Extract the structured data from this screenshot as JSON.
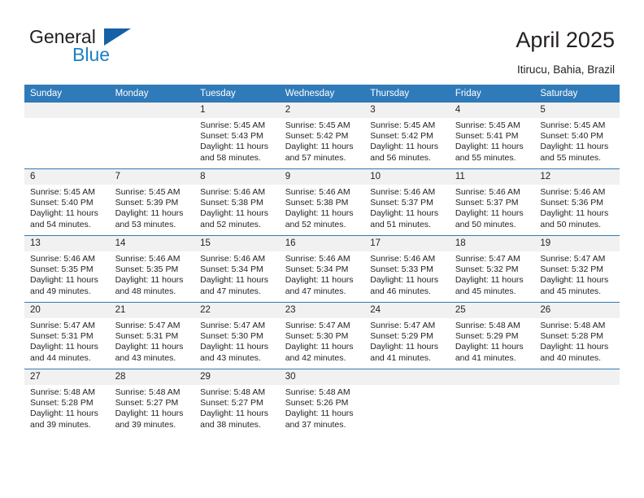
{
  "brand": {
    "word_one": "General",
    "word_two": "Blue",
    "triangle_color": "#1660a8",
    "blue_text_color": "#1d7fc4"
  },
  "header": {
    "title": "April 2025",
    "location": "Itirucu, Bahia, Brazil"
  },
  "theme": {
    "header_row_bg": "#2f7ab9",
    "daynum_bg": "#f1f1f1",
    "grid_line": "#2f7ab9",
    "text": "#231f20"
  },
  "labels": {
    "sunrise_prefix": "Sunrise:",
    "sunset_prefix": "Sunset:",
    "daylight_prefix": "Daylight:"
  },
  "weekdays": [
    "Sunday",
    "Monday",
    "Tuesday",
    "Wednesday",
    "Thursday",
    "Friday",
    "Saturday"
  ],
  "weeks": [
    [
      {
        "day": "",
        "empty": true
      },
      {
        "day": "",
        "empty": true
      },
      {
        "day": "1",
        "sunrise": "Sunrise: 5:45 AM",
        "sunset": "Sunset: 5:43 PM",
        "daylight": "Daylight: 11 hours and 58 minutes."
      },
      {
        "day": "2",
        "sunrise": "Sunrise: 5:45 AM",
        "sunset": "Sunset: 5:42 PM",
        "daylight": "Daylight: 11 hours and 57 minutes."
      },
      {
        "day": "3",
        "sunrise": "Sunrise: 5:45 AM",
        "sunset": "Sunset: 5:42 PM",
        "daylight": "Daylight: 11 hours and 56 minutes."
      },
      {
        "day": "4",
        "sunrise": "Sunrise: 5:45 AM",
        "sunset": "Sunset: 5:41 PM",
        "daylight": "Daylight: 11 hours and 55 minutes."
      },
      {
        "day": "5",
        "sunrise": "Sunrise: 5:45 AM",
        "sunset": "Sunset: 5:40 PM",
        "daylight": "Daylight: 11 hours and 55 minutes."
      }
    ],
    [
      {
        "day": "6",
        "sunrise": "Sunrise: 5:45 AM",
        "sunset": "Sunset: 5:40 PM",
        "daylight": "Daylight: 11 hours and 54 minutes."
      },
      {
        "day": "7",
        "sunrise": "Sunrise: 5:45 AM",
        "sunset": "Sunset: 5:39 PM",
        "daylight": "Daylight: 11 hours and 53 minutes."
      },
      {
        "day": "8",
        "sunrise": "Sunrise: 5:46 AM",
        "sunset": "Sunset: 5:38 PM",
        "daylight": "Daylight: 11 hours and 52 minutes."
      },
      {
        "day": "9",
        "sunrise": "Sunrise: 5:46 AM",
        "sunset": "Sunset: 5:38 PM",
        "daylight": "Daylight: 11 hours and 52 minutes."
      },
      {
        "day": "10",
        "sunrise": "Sunrise: 5:46 AM",
        "sunset": "Sunset: 5:37 PM",
        "daylight": "Daylight: 11 hours and 51 minutes."
      },
      {
        "day": "11",
        "sunrise": "Sunrise: 5:46 AM",
        "sunset": "Sunset: 5:37 PM",
        "daylight": "Daylight: 11 hours and 50 minutes."
      },
      {
        "day": "12",
        "sunrise": "Sunrise: 5:46 AM",
        "sunset": "Sunset: 5:36 PM",
        "daylight": "Daylight: 11 hours and 50 minutes."
      }
    ],
    [
      {
        "day": "13",
        "sunrise": "Sunrise: 5:46 AM",
        "sunset": "Sunset: 5:35 PM",
        "daylight": "Daylight: 11 hours and 49 minutes."
      },
      {
        "day": "14",
        "sunrise": "Sunrise: 5:46 AM",
        "sunset": "Sunset: 5:35 PM",
        "daylight": "Daylight: 11 hours and 48 minutes."
      },
      {
        "day": "15",
        "sunrise": "Sunrise: 5:46 AM",
        "sunset": "Sunset: 5:34 PM",
        "daylight": "Daylight: 11 hours and 47 minutes."
      },
      {
        "day": "16",
        "sunrise": "Sunrise: 5:46 AM",
        "sunset": "Sunset: 5:34 PM",
        "daylight": "Daylight: 11 hours and 47 minutes."
      },
      {
        "day": "17",
        "sunrise": "Sunrise: 5:46 AM",
        "sunset": "Sunset: 5:33 PM",
        "daylight": "Daylight: 11 hours and 46 minutes."
      },
      {
        "day": "18",
        "sunrise": "Sunrise: 5:47 AM",
        "sunset": "Sunset: 5:32 PM",
        "daylight": "Daylight: 11 hours and 45 minutes."
      },
      {
        "day": "19",
        "sunrise": "Sunrise: 5:47 AM",
        "sunset": "Sunset: 5:32 PM",
        "daylight": "Daylight: 11 hours and 45 minutes."
      }
    ],
    [
      {
        "day": "20",
        "sunrise": "Sunrise: 5:47 AM",
        "sunset": "Sunset: 5:31 PM",
        "daylight": "Daylight: 11 hours and 44 minutes."
      },
      {
        "day": "21",
        "sunrise": "Sunrise: 5:47 AM",
        "sunset": "Sunset: 5:31 PM",
        "daylight": "Daylight: 11 hours and 43 minutes."
      },
      {
        "day": "22",
        "sunrise": "Sunrise: 5:47 AM",
        "sunset": "Sunset: 5:30 PM",
        "daylight": "Daylight: 11 hours and 43 minutes."
      },
      {
        "day": "23",
        "sunrise": "Sunrise: 5:47 AM",
        "sunset": "Sunset: 5:30 PM",
        "daylight": "Daylight: 11 hours and 42 minutes."
      },
      {
        "day": "24",
        "sunrise": "Sunrise: 5:47 AM",
        "sunset": "Sunset: 5:29 PM",
        "daylight": "Daylight: 11 hours and 41 minutes."
      },
      {
        "day": "25",
        "sunrise": "Sunrise: 5:48 AM",
        "sunset": "Sunset: 5:29 PM",
        "daylight": "Daylight: 11 hours and 41 minutes."
      },
      {
        "day": "26",
        "sunrise": "Sunrise: 5:48 AM",
        "sunset": "Sunset: 5:28 PM",
        "daylight": "Daylight: 11 hours and 40 minutes."
      }
    ],
    [
      {
        "day": "27",
        "sunrise": "Sunrise: 5:48 AM",
        "sunset": "Sunset: 5:28 PM",
        "daylight": "Daylight: 11 hours and 39 minutes."
      },
      {
        "day": "28",
        "sunrise": "Sunrise: 5:48 AM",
        "sunset": "Sunset: 5:27 PM",
        "daylight": "Daylight: 11 hours and 39 minutes."
      },
      {
        "day": "29",
        "sunrise": "Sunrise: 5:48 AM",
        "sunset": "Sunset: 5:27 PM",
        "daylight": "Daylight: 11 hours and 38 minutes."
      },
      {
        "day": "30",
        "sunrise": "Sunrise: 5:48 AM",
        "sunset": "Sunset: 5:26 PM",
        "daylight": "Daylight: 11 hours and 37 minutes."
      },
      {
        "day": "",
        "empty": true
      },
      {
        "day": "",
        "empty": true
      },
      {
        "day": "",
        "empty": true
      }
    ]
  ]
}
